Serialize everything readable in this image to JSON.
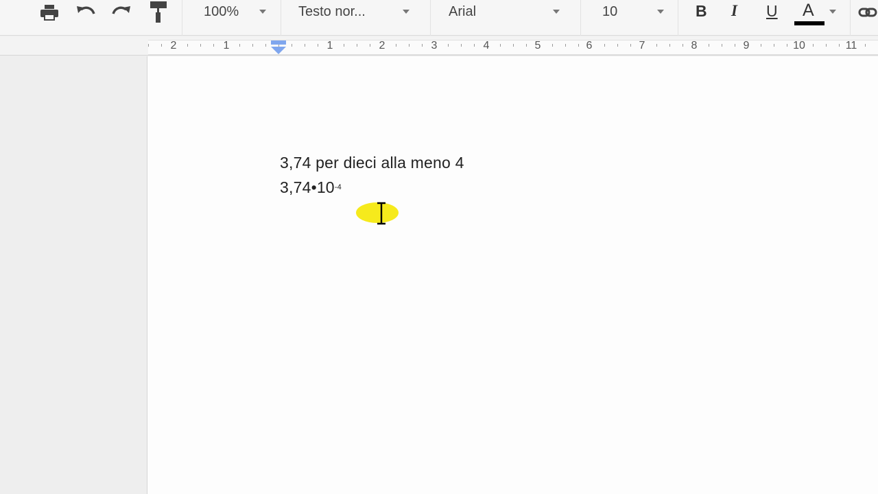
{
  "toolbar": {
    "zoom": "100%",
    "style": "Testo nor...",
    "font": "Arial",
    "size": "10",
    "bold_label": "B",
    "italic_label": "I",
    "underline_label": "U",
    "text_color_label": "A",
    "text_color": "#000000",
    "icons": [
      "print-icon",
      "undo-icon",
      "redo-icon",
      "paint-format-icon",
      "link-icon"
    ]
  },
  "ruler": {
    "labels": [
      "2",
      "1",
      "1",
      "2",
      "3",
      "4",
      "5",
      "6",
      "7",
      "8",
      "9",
      "10",
      "11"
    ]
  },
  "document": {
    "line1": "3,74 per dieci alla meno 4",
    "line2_base": "3,74•10",
    "line2_exponent": "-4"
  },
  "colors": {
    "cursor_highlight": "#f6ea1c",
    "indent_marker": "#7fa6ee"
  }
}
